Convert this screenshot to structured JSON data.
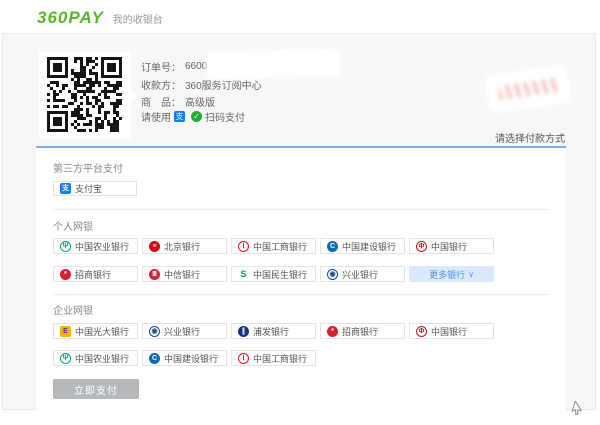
{
  "header": {
    "logo_text": "360PAY",
    "subtitle": "我的收银台"
  },
  "order": {
    "rows": [
      {
        "label": "订单号：",
        "value": "6600"
      },
      {
        "label": "收款方：",
        "value": "360服务订阅中心"
      },
      {
        "label": "商　品：",
        "value": "高级版"
      }
    ],
    "scan_prefix": "请使用",
    "scan_suffix": "扫码支付",
    "alipay_icon_glyph": "支",
    "wechat_icon_glyph": "✓"
  },
  "payment": {
    "choose_label": "请选择付款方式",
    "third_party_title": "第三方平台支付",
    "alipay": {
      "label": "支付宝",
      "icon": "alipay-icon",
      "glyph": "支",
      "color": "#1678ff",
      "style": "solid",
      "shape": "square"
    },
    "personal_title": "个人网银",
    "corporate_title": "企业网银",
    "more_banks_label": "更多银行",
    "chevron_down_glyph": "∨",
    "pay_button_label": "立即支付",
    "personal_row1": [
      {
        "label": "中国农业银行",
        "icon": "abc-bank-icon",
        "glyph": "Ψ",
        "color": "#00a183",
        "style": "ring"
      },
      {
        "label": "北京银行",
        "icon": "bob-bank-icon",
        "glyph": "≡",
        "color": "#d7000f",
        "style": "solid"
      },
      {
        "label": "中国工商银行",
        "icon": "icbc-bank-icon",
        "glyph": "Ⅰ",
        "color": "#e3101e",
        "style": "ring"
      },
      {
        "label": "中国建设银行",
        "icon": "ccb-bank-icon",
        "glyph": "C",
        "color": "#0b6bb2",
        "style": "solid"
      },
      {
        "label": "中国银行",
        "icon": "boc-bank-icon",
        "glyph": "Φ",
        "color": "#c6161d",
        "style": "ring"
      }
    ],
    "personal_row2": [
      {
        "label": "招商银行",
        "icon": "cmb-bank-icon",
        "glyph": "*",
        "color": "#d7212f",
        "style": "solid"
      },
      {
        "label": "中信银行",
        "icon": "citic-bank-icon",
        "glyph": "Ⅲ",
        "color": "#d7212f",
        "style": "solid"
      },
      {
        "label": "中国民生银行",
        "icon": "cmbc-bank-icon",
        "glyph": "S",
        "color": "#00a083",
        "style": "bare"
      },
      {
        "label": "兴业银行",
        "icon": "cib-bank-icon",
        "glyph": "◉",
        "color": "#164a9c",
        "style": "ring"
      }
    ],
    "corporate_row1": [
      {
        "label": "中国光大银行",
        "icon": "ceb-bank-icon",
        "glyph": "E",
        "color": "#f3b200",
        "fg": "#5c2d91",
        "style": "solid",
        "shape": "square"
      },
      {
        "label": "兴业银行",
        "icon": "cib-bank-icon",
        "glyph": "◉",
        "color": "#164a9c",
        "style": "ring"
      },
      {
        "label": "浦发银行",
        "icon": "spdb-bank-icon",
        "glyph": "∥",
        "color": "#13357f",
        "style": "solid"
      },
      {
        "label": "招商银行",
        "icon": "cmb-bank-icon",
        "glyph": "*",
        "color": "#d7212f",
        "style": "solid"
      },
      {
        "label": "中国银行",
        "icon": "boc-bank-icon",
        "glyph": "Φ",
        "color": "#c6161d",
        "style": "ring"
      }
    ],
    "corporate_row2": [
      {
        "label": "中国农业银行",
        "icon": "abc-bank-icon",
        "glyph": "Ψ",
        "color": "#00a183",
        "style": "ring"
      },
      {
        "label": "中国建设银行",
        "icon": "ccb-bank-icon",
        "glyph": "C",
        "color": "#0b6bb2",
        "style": "solid"
      },
      {
        "label": "中国工商银行",
        "icon": "icbc-bank-icon",
        "glyph": "Ⅰ",
        "color": "#e3101e",
        "style": "ring"
      }
    ]
  },
  "colors": {
    "brand_green": "#5ab52e",
    "tab_blue": "#79b2ea",
    "more_bg": "#dce9fb",
    "more_text": "#4f8ef7",
    "pay_disabled": "#b6b9bb"
  }
}
